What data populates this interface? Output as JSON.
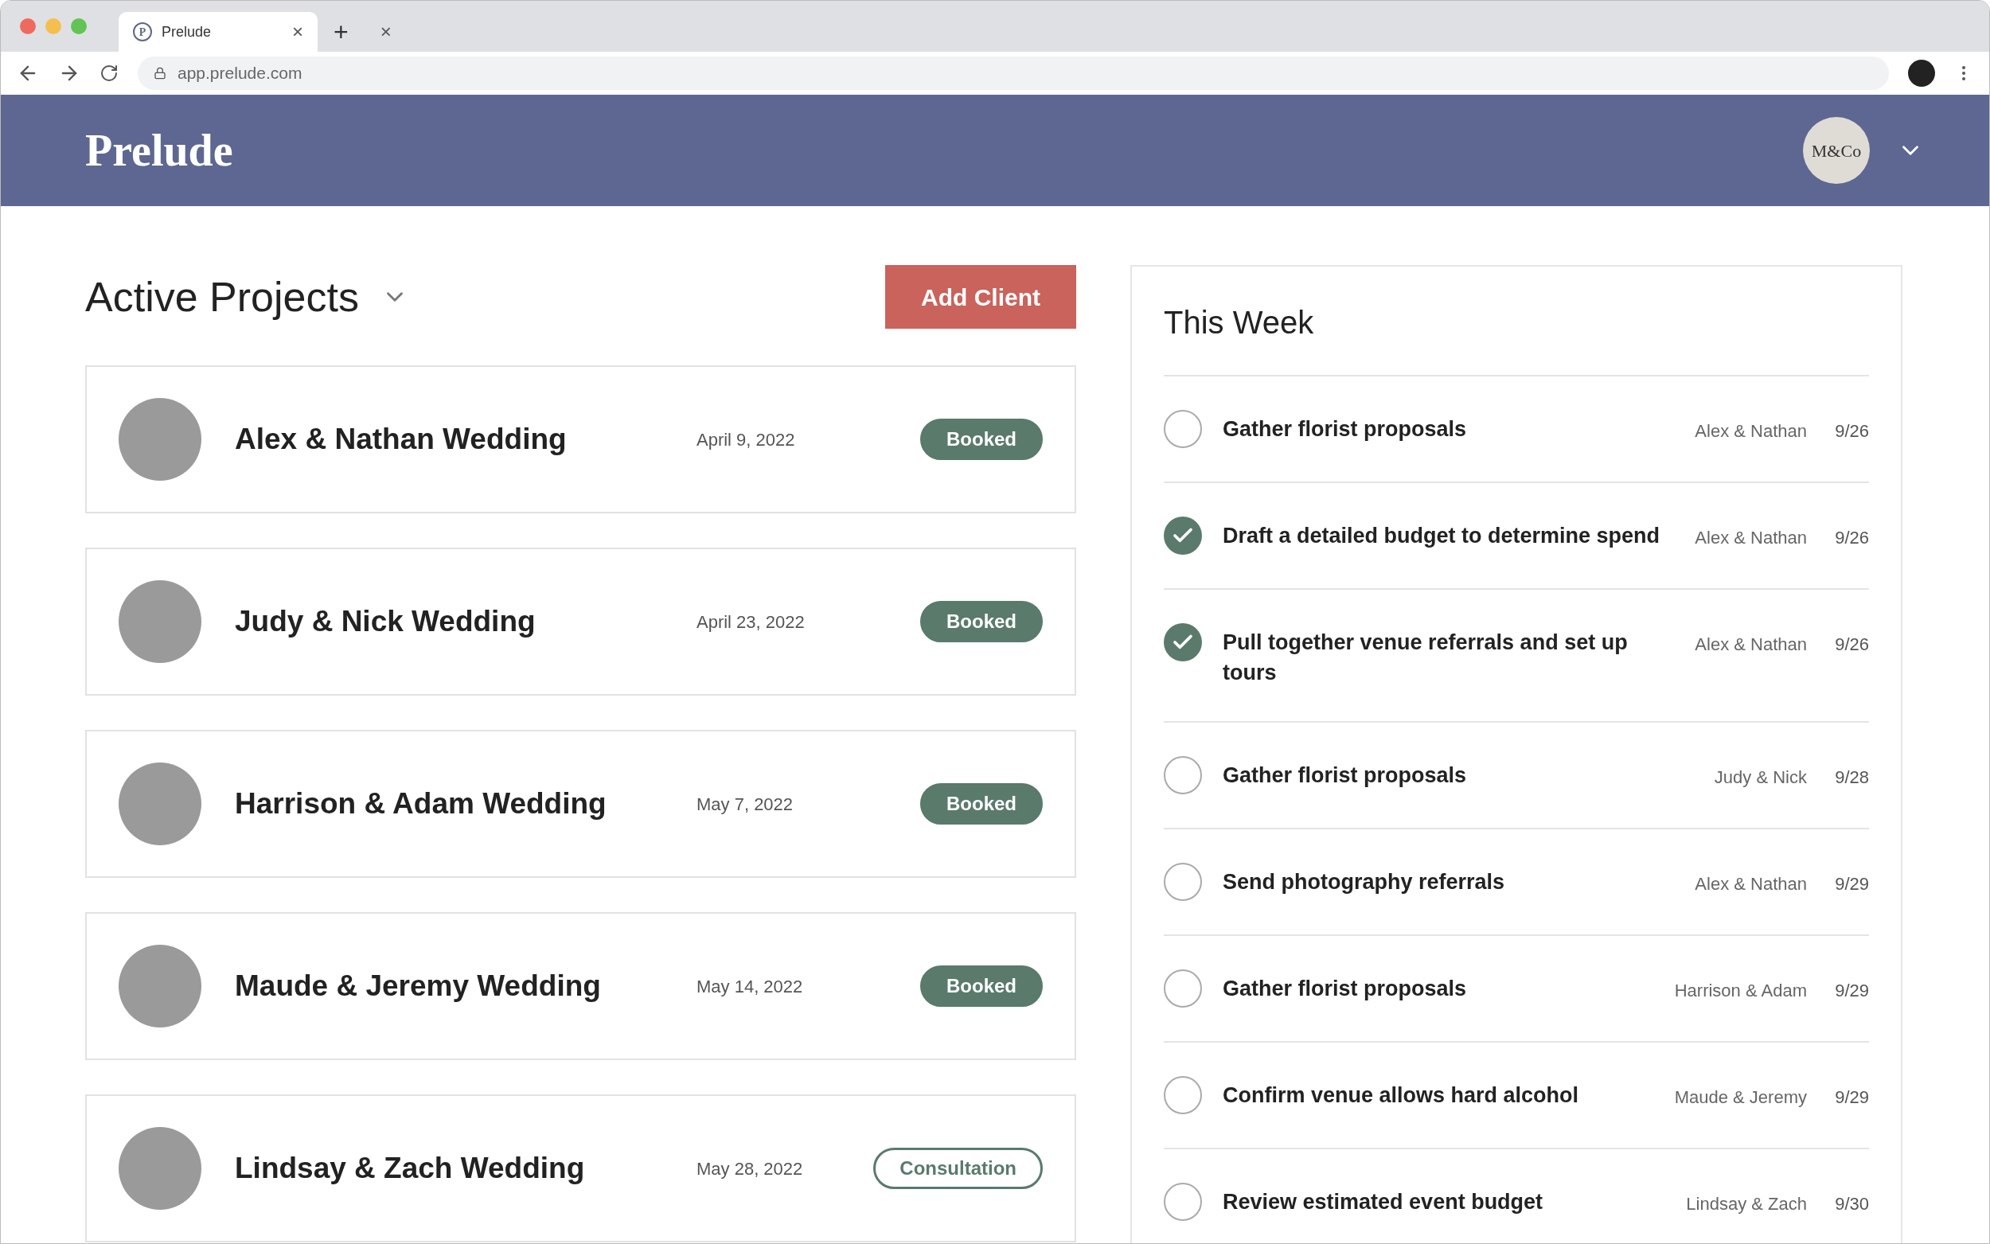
{
  "browser": {
    "tab": {
      "favicon": "P",
      "title": "Prelude"
    },
    "new_tab": "+",
    "close": "×",
    "url": "app.prelude.com"
  },
  "header": {
    "logo": "Prelude",
    "account": "M&Co"
  },
  "projects": {
    "title": "Active Projects",
    "add_button": "Add Client",
    "items": [
      {
        "name": "Alex & Nathan Wedding",
        "date": "April 9, 2022",
        "status": "Booked",
        "kind": "booked"
      },
      {
        "name": "Judy & Nick Wedding",
        "date": "April 23, 2022",
        "status": "Booked",
        "kind": "booked"
      },
      {
        "name": "Harrison & Adam Wedding",
        "date": "May 7, 2022",
        "status": "Booked",
        "kind": "booked"
      },
      {
        "name": "Maude & Jeremy Wedding",
        "date": "May 14, 2022",
        "status": "Booked",
        "kind": "booked"
      },
      {
        "name": "Lindsay & Zach Wedding",
        "date": "May 28, 2022",
        "status": "Consultation",
        "kind": "consultation"
      }
    ]
  },
  "this_week": {
    "title": "This Week",
    "tasks": [
      {
        "text": "Gather florist proposals",
        "client": "Alex & Nathan",
        "due": "9/26",
        "checked": false
      },
      {
        "text": "Draft a detailed budget to determine spend",
        "client": "Alex & Nathan",
        "due": "9/26",
        "checked": true
      },
      {
        "text": "Pull together venue referrals and set up tours",
        "client": "Alex & Nathan",
        "due": "9/26",
        "checked": true
      },
      {
        "text": "Gather florist proposals",
        "client": "Judy & Nick",
        "due": "9/28",
        "checked": false
      },
      {
        "text": "Send photography referrals",
        "client": "Alex & Nathan",
        "due": "9/29",
        "checked": false
      },
      {
        "text": "Gather florist proposals",
        "client": "Harrison & Adam",
        "due": "9/29",
        "checked": false
      },
      {
        "text": "Confirm venue allows hard alcohol",
        "client": "Maude & Jeremy",
        "due": "9/29",
        "checked": false
      },
      {
        "text": "Review estimated event budget",
        "client": "Lindsay & Zach",
        "due": "9/30",
        "checked": false
      }
    ]
  }
}
